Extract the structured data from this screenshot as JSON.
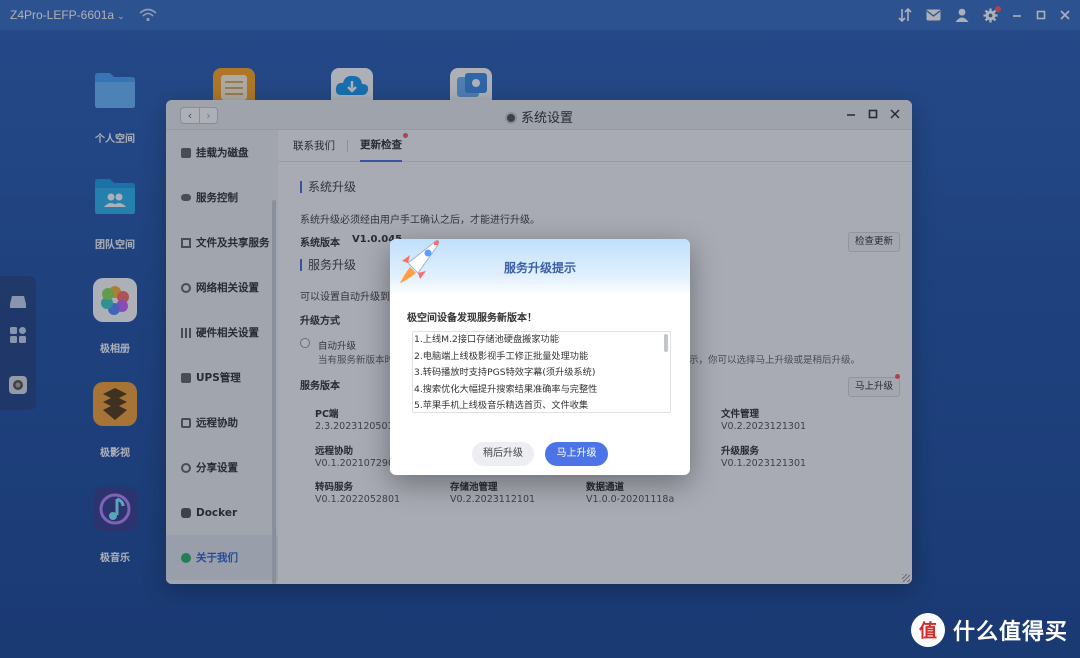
{
  "topbar": {
    "device_name": "Z4Pro-LEFP-6601a",
    "caret": "⌄"
  },
  "desktop": {
    "icons": [
      {
        "label": "个人空间"
      },
      {
        "label": "团队空间"
      },
      {
        "label": "极相册"
      },
      {
        "label": "极影视"
      },
      {
        "label": "极音乐"
      }
    ]
  },
  "window": {
    "title": "系统设置",
    "nav_back": "‹",
    "nav_forward": "›",
    "sidebar": [
      {
        "label": "挂载为磁盘",
        "icon": "disk-icon"
      },
      {
        "label": "服务控制",
        "icon": "toggle-icon"
      },
      {
        "label": "文件及共享服务",
        "icon": "share-icon"
      },
      {
        "label": "网络相关设置",
        "icon": "globe-icon"
      },
      {
        "label": "硬件相关设置",
        "icon": "grid-icon"
      },
      {
        "label": "UPS管理",
        "icon": "battery-icon"
      },
      {
        "label": "远程协助",
        "icon": "remote-icon"
      },
      {
        "label": "分享设置",
        "icon": "share-settings-icon"
      },
      {
        "label": "Docker",
        "icon": "docker-icon"
      },
      {
        "label": "关于我们",
        "icon": "info-icon"
      }
    ],
    "tabs": [
      {
        "label": "联系我们"
      },
      {
        "label": "更新检查"
      }
    ],
    "system_upgrade": {
      "title": "系统升级",
      "desc": "系统升级必须经由用户手工确认之后，才能进行升级。",
      "version_label": "系统版本",
      "version_value": "V1.0.045",
      "check_button": "检查更新"
    },
    "service_upgrade": {
      "title": "服务升级",
      "desc": "可以设置自动升级到",
      "method_label": "升级方式",
      "auto_option": "自动升级",
      "auto_hint": "当有服务新版本时",
      "hint_tail": "示，你可以选择马上升级或是稍后升级。",
      "versions_label": "服务版本",
      "upgrade_now_button": "马上升级",
      "services": [
        {
          "name": "PC端",
          "version": "2.3.2023120501"
        },
        {
          "name": "文件管理",
          "version": "V0.2.2023121301"
        },
        {
          "name": "远程协助",
          "version": "V0.1.2021072901"
        },
        {
          "name": "升级服务",
          "version": "V0.1.2023121301"
        },
        {
          "name": "转码服务",
          "version": "V0.1.2022052801"
        },
        {
          "name": "存储池管理",
          "version": "V0.2.2023112101"
        },
        {
          "name": "数据通道",
          "version": "V1.0.0-20201118a"
        }
      ]
    }
  },
  "dialog": {
    "title": "服务升级提示",
    "message": "极空间设备发现服务新版本！",
    "notes": [
      "1.上线M.2接口存储池硬盘搬家功能",
      "2.电脑端上线极影视手工修正批量处理功能",
      "3.转码播放时支持PGS特效字幕(须升级系统)",
      "4.搜索优化大幅提升搜索结果准确率与完整性",
      "5.苹果手机上线极音乐精选首页、文件收集"
    ],
    "later_button": "稍后升级",
    "now_button": "马上升级"
  },
  "watermark": {
    "text": "什么值得买",
    "logo": "值"
  },
  "colors": {
    "accent": "#4d74e6",
    "desktop_bg": "#2556a8",
    "notify_dot": "#ff5a5a"
  }
}
